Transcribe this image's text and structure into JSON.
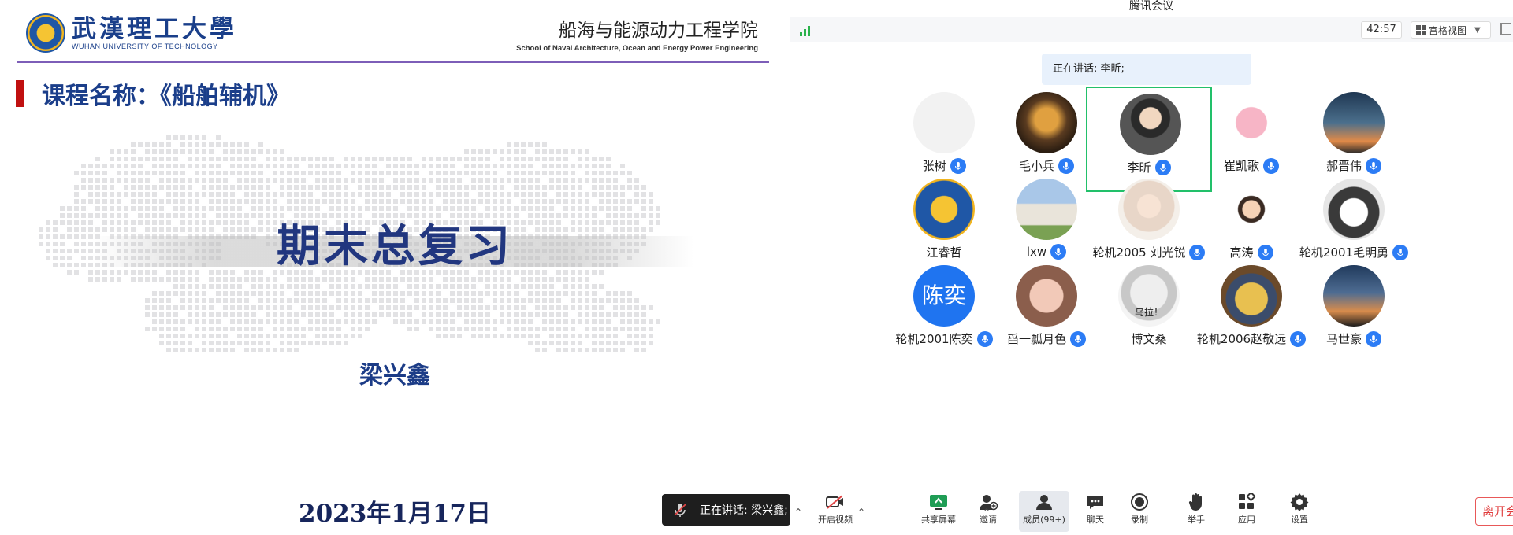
{
  "slide": {
    "university_cn": "武漢理工大學",
    "university_en": "WUHAN UNIVERSITY OF TECHNOLOGY",
    "school_cn": "船海与能源动力工程学院",
    "school_en": "School of Naval Architecture, Ocean and Energy Power Engineering",
    "course": "课程名称：《船舶辅机》",
    "title": "期末总复习",
    "lecturer": "梁兴鑫",
    "date": "2023年1月17日"
  },
  "speaking_toast": "正在讲话: 梁兴鑫;",
  "meeting": {
    "app_title": "腾讯会议",
    "timer": "42:57",
    "view_label": "宫格视图",
    "speaking_banner": "正在讲话: 李昕;",
    "participants": [
      {
        "name": "张树",
        "avatar": "cyclist-sketch-avatar",
        "mic": true
      },
      {
        "name": "毛小兵",
        "avatar": "cartoon-figure-avatar",
        "mic": true
      },
      {
        "name": "李昕",
        "avatar": "person-photo-avatar",
        "mic": true,
        "active": true
      },
      {
        "name": "崔凯歌",
        "avatar": "pink-cartoon-avatar",
        "mic": true
      },
      {
        "name": "郝晋伟",
        "avatar": "sunset-sky-avatar",
        "mic": true
      },
      {
        "name": "江睿哲",
        "avatar": "university-logo-avatar",
        "mic": false
      },
      {
        "name": "lxw",
        "avatar": "sheep-avatar",
        "mic": true
      },
      {
        "name": "轮机2005 刘光锐",
        "avatar": "anime-girl-avatar",
        "mic": true
      },
      {
        "name": "高涛",
        "avatar": "chibi-boy-avatar",
        "mic": true
      },
      {
        "name": "轮机2001毛明勇",
        "avatar": "dog-avatar",
        "mic": true
      },
      {
        "name": "轮机2001陈奕",
        "avatar_text": "陈奕",
        "mic": true
      },
      {
        "name": "舀一瓢月色",
        "avatar": "pig-sunglasses-avatar",
        "mic": true
      },
      {
        "name": "博文桑",
        "avatar": "meme-face-avatar",
        "avatar_caption": "乌拉！",
        "mic": false
      },
      {
        "name": "轮机2006赵敬远",
        "avatar": "ninja-cartoon-avatar",
        "mic": true
      },
      {
        "name": "马世豪",
        "avatar": "dusk-landscape-avatar",
        "mic": true
      }
    ],
    "toolbar": [
      {
        "label": "开启视频",
        "icon": "video-off-icon"
      },
      {
        "label": "共享屏幕",
        "icon": "share-screen-icon"
      },
      {
        "label": "邀请",
        "icon": "invite-icon"
      },
      {
        "label": "成员(99+)",
        "icon": "members-icon"
      },
      {
        "label": "聊天",
        "icon": "chat-icon"
      },
      {
        "label": "录制",
        "icon": "record-icon"
      },
      {
        "label": "举手",
        "icon": "raise-hand-icon"
      },
      {
        "label": "应用",
        "icon": "apps-icon"
      },
      {
        "label": "设置",
        "icon": "settings-icon"
      }
    ],
    "leave_label": "离开会议"
  },
  "colors": {
    "accent": "#2c7cf5",
    "active_border": "#22c06a",
    "leave": "#e03c3c",
    "slide_title": "#21367f"
  }
}
